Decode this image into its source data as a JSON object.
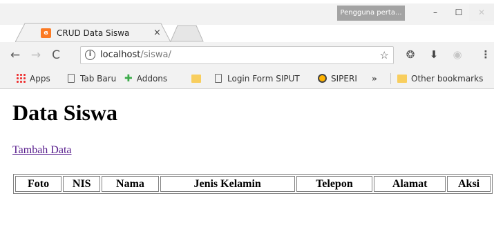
{
  "browser": {
    "user_chip": "Pengguna perta...",
    "window_controls": {
      "minimize": "–",
      "maximize": "☐",
      "close": "✕"
    },
    "tab": {
      "title": "CRUD Data Siswa",
      "close": "×",
      "favicon": "xampp-icon"
    },
    "address": {
      "host": "localhost",
      "path": "/siswa/"
    },
    "nav": {
      "back": "←",
      "forward": "→",
      "reload": "C"
    },
    "bookmarks": [
      {
        "label": "Apps",
        "icon": "apps-grid-icon"
      },
      {
        "label": "Tab Baru",
        "icon": "page-icon"
      },
      {
        "label": "Addons",
        "icon": "puzzle-icon"
      },
      {
        "label": "",
        "icon": "folder-icon"
      },
      {
        "label": "Login Form SIPUT",
        "icon": "page-icon"
      },
      {
        "label": "SIPERI",
        "icon": "site-icon"
      },
      {
        "label": "»",
        "icon": "more-icon"
      },
      {
        "label": "Other bookmarks",
        "icon": "folder-icon"
      }
    ]
  },
  "page": {
    "title": "Data Siswa",
    "add_link": "Tambah Data",
    "table": {
      "headers": [
        "Foto",
        "NIS",
        "Nama",
        "Jenis Kelamin",
        "Telepon",
        "Alamat",
        "Aksi"
      ],
      "rows": []
    }
  }
}
